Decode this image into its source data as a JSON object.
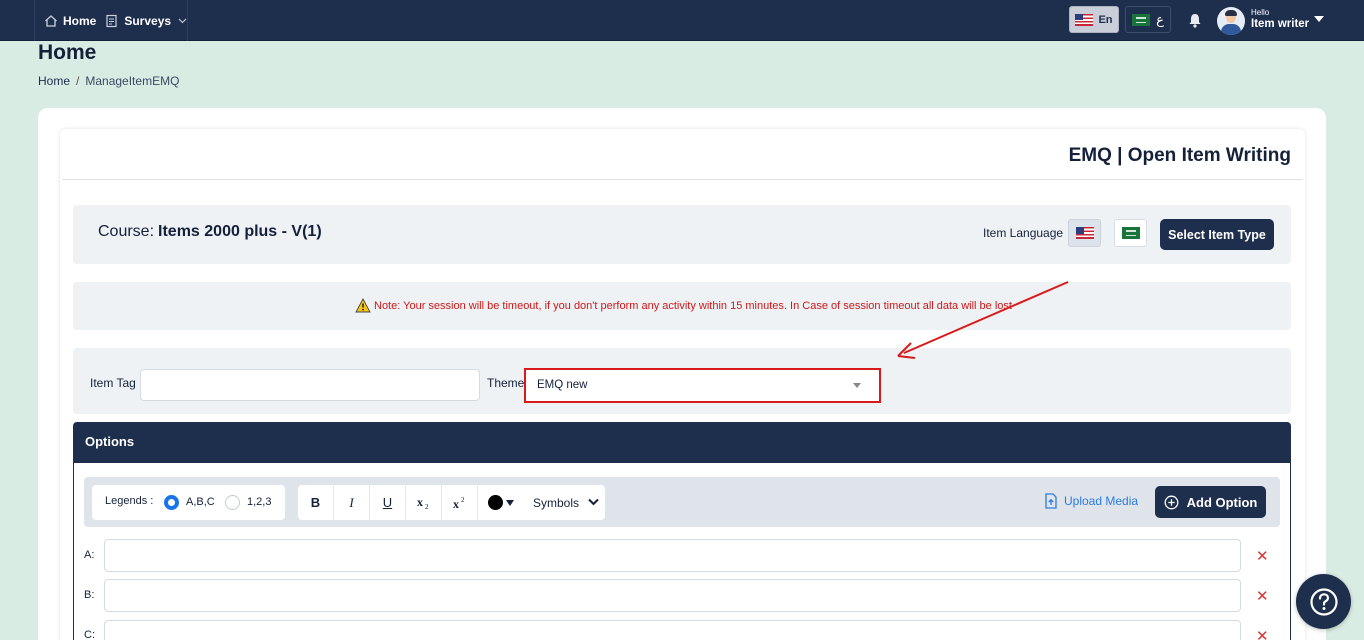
{
  "nav": {
    "home": "Home",
    "surveys": "Surveys",
    "lang_en": "En",
    "lang_ar": "ع",
    "hello": "Hello",
    "user_name": "Item writer"
  },
  "page": {
    "title": "Home",
    "breadcrumb_home": "Home",
    "breadcrumb_sep": "/",
    "breadcrumb_current": "ManageItemEMQ"
  },
  "card": {
    "title": "EMQ | Open Item Writing",
    "course_label": "Course:",
    "course_value": "Items 2000 plus - V(1)",
    "item_language_label": "Item Language",
    "select_item_type": "Select Item Type",
    "note": "Note: Your session will be timeout, if you don't perform any activity within 15 minutes. In Case of session timeout all data will be lost",
    "item_tag_label": "Item Tag",
    "item_tag_value": "",
    "theme_label": "Theme",
    "theme_value": "EMQ new"
  },
  "options": {
    "title": "Options",
    "legends_label": "Legends :",
    "legend_abc": "A,B,C",
    "legend_123": "1,2,3",
    "fmt_bold": "B",
    "fmt_italic": "I",
    "fmt_underline": "U",
    "symbols": "Symbols",
    "upload_media": "Upload Media",
    "add_option": "Add Option",
    "rows": [
      {
        "label": "A:",
        "value": ""
      },
      {
        "label": "B:",
        "value": ""
      },
      {
        "label": "C:",
        "value": ""
      }
    ],
    "delete_glyph": "✕"
  },
  "colors": {
    "navy": "#1e2e4d",
    "background": "#d9ece3",
    "note_red": "#d01818",
    "highlight_red": "#d91a1a",
    "link_blue": "#2a7de1"
  }
}
